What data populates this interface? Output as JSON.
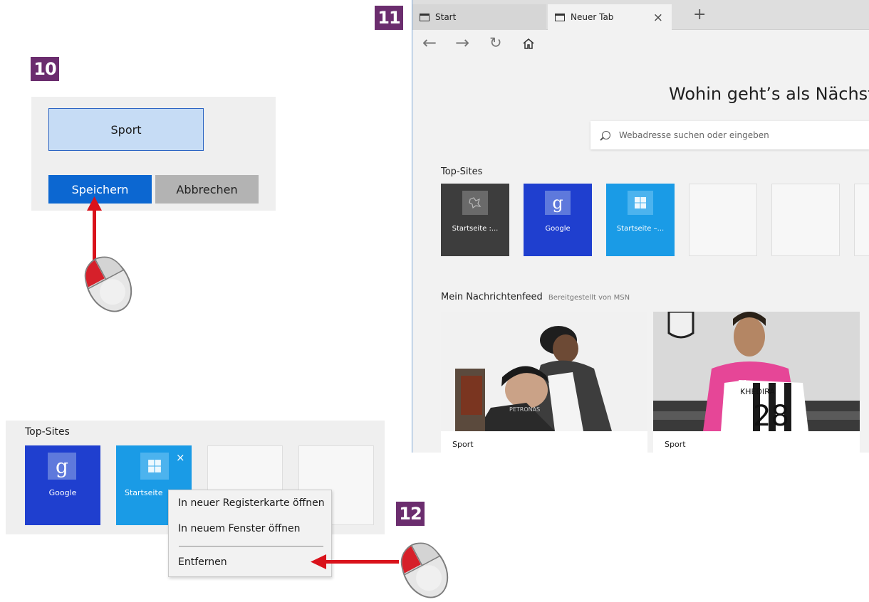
{
  "steps": {
    "step10": "10",
    "step11": "11",
    "step12": "12"
  },
  "panel10": {
    "input_value": "Sport",
    "save_label": "Speichern",
    "cancel_label": "Abbrechen"
  },
  "browser": {
    "tabs": [
      {
        "label": "Start"
      },
      {
        "label": "Neuer Tab"
      }
    ],
    "headline": "Wohin geht’s als Nächstes?",
    "search_placeholder": "Webadresse suchen oder eingeben",
    "top_sites_label": "Top-Sites",
    "top_sites": [
      {
        "label": "Startseite :..."
      },
      {
        "label": "Google"
      },
      {
        "label": "Startseite –..."
      }
    ],
    "newsfeed_title": "Mein Nachrichtenfeed",
    "newsfeed_source": "Bereitgestellt von MSN",
    "news": [
      {
        "tag": "Sport"
      },
      {
        "tag": "Sport",
        "jersey_name": "KHEDIRA",
        "jersey_number": "28"
      }
    ]
  },
  "panel12": {
    "top_sites_label": "Top-Sites",
    "tiles": [
      {
        "label": "Google"
      },
      {
        "label": "Startseite"
      }
    ],
    "context_menu": {
      "items": [
        "In neuer Registerkarte öffnen",
        "In neuem Fenster öffnen",
        "Entfernen"
      ]
    }
  },
  "colors": {
    "badge": "#6b2d6e",
    "save_button": "#0c67d1",
    "google_tile": "#1f3fcf",
    "windows_tile": "#1a9be6",
    "arrow": "#d9121b"
  }
}
